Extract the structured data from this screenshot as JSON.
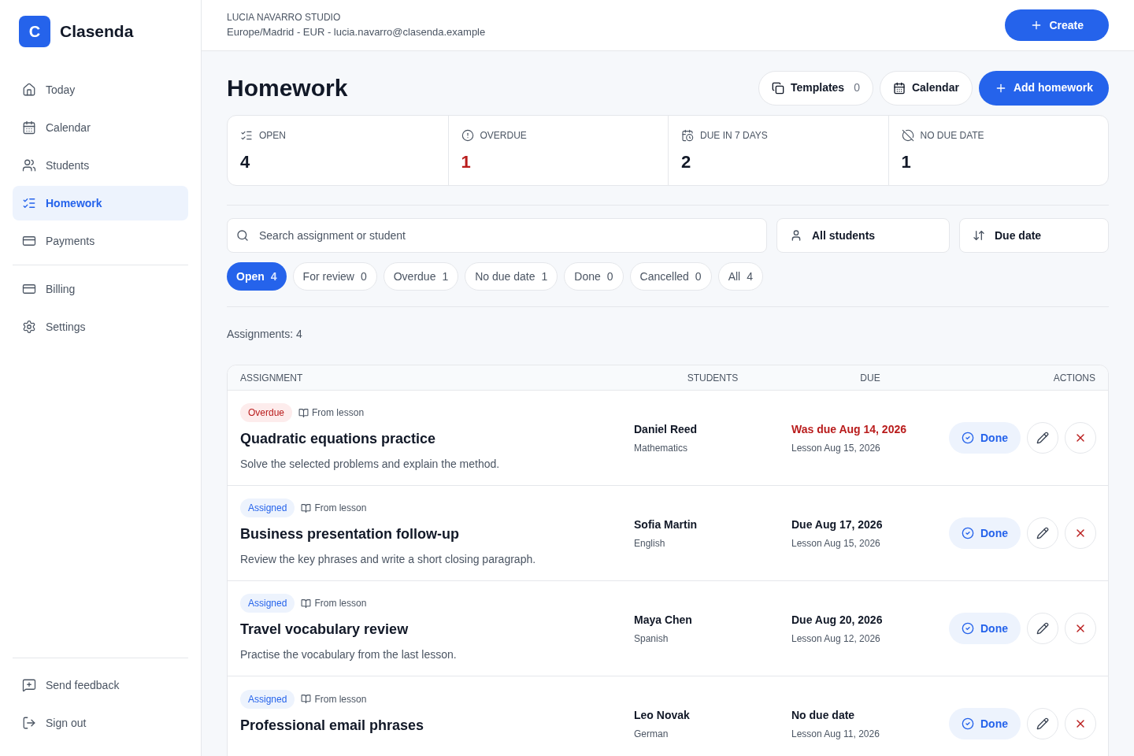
{
  "brand": {
    "logo_letter": "C",
    "name": "Clasenda"
  },
  "sidebar": {
    "items": [
      {
        "label": "Today",
        "kind": "home",
        "selected": false
      },
      {
        "label": "Calendar",
        "kind": "calendar",
        "selected": false
      },
      {
        "label": "Students",
        "kind": "users",
        "selected": false
      },
      {
        "label": "Homework",
        "kind": "list",
        "selected": true
      },
      {
        "label": "Payments",
        "kind": "card",
        "selected": false
      }
    ],
    "secondary": [
      {
        "label": "Billing",
        "kind": "card",
        "selected": false
      },
      {
        "label": "Settings",
        "kind": "gear",
        "selected": false
      }
    ],
    "footer": [
      {
        "label": "Send feedback",
        "kind": "feedback"
      },
      {
        "label": "Sign out",
        "kind": "signout"
      }
    ]
  },
  "header": {
    "studio": "LUCIA NAVARRO STUDIO",
    "details": "Europe/Madrid - EUR - lucia.navarro@clasenda.example",
    "create_button": "Create"
  },
  "page": {
    "title": "Homework",
    "templates_button": {
      "label": "Templates",
      "count": "0"
    },
    "calendar_button": "Calendar",
    "add_button": "Add homework"
  },
  "stats": [
    {
      "label": "OPEN",
      "value": "4",
      "kind": "list",
      "alert": false
    },
    {
      "label": "OVERDUE",
      "value": "1",
      "kind": "alert",
      "alert": true
    },
    {
      "label": "DUE IN 7 DAYS",
      "value": "2",
      "kind": "calclock",
      "alert": false
    },
    {
      "label": "NO DUE DATE",
      "value": "1",
      "kind": "off",
      "alert": false
    }
  ],
  "search": {
    "placeholder": "Search assignment or student"
  },
  "student_filter": "All students",
  "sort": "Due date",
  "filters": [
    {
      "label": "Open",
      "count": "4",
      "selected": true
    },
    {
      "label": "For review",
      "count": "0",
      "selected": false
    },
    {
      "label": "Overdue",
      "count": "1",
      "selected": false
    },
    {
      "label": "No due date",
      "count": "1",
      "selected": false
    },
    {
      "label": "Done",
      "count": "0",
      "selected": false
    },
    {
      "label": "Cancelled",
      "count": "0",
      "selected": false
    },
    {
      "label": "All",
      "count": "4",
      "selected": false
    }
  ],
  "summary": "Assignments: 4",
  "table": {
    "columns": [
      "ASSIGNMENT",
      "STUDENTS",
      "DUE",
      "ACTIONS"
    ],
    "rows": [
      {
        "status": {
          "kind": "overdue",
          "label": "Overdue"
        },
        "source": "From lesson",
        "title": "Quadratic equations practice",
        "description": "Solve the selected problems and explain the method.",
        "student": "Daniel Reed",
        "subject": "Mathematics",
        "due": "Was due Aug 14, 2026",
        "due_overdue": true,
        "lesson": "Lesson Aug 15, 2026",
        "done_button": "Done"
      },
      {
        "status": {
          "kind": "assigned",
          "label": "Assigned"
        },
        "source": "From lesson",
        "title": "Business presentation follow-up",
        "description": "Review the key phrases and write a short closing paragraph.",
        "student": "Sofia Martin",
        "subject": "English",
        "due": "Due Aug 17, 2026",
        "due_overdue": false,
        "lesson": "Lesson Aug 15, 2026",
        "done_button": "Done"
      },
      {
        "status": {
          "kind": "assigned",
          "label": "Assigned"
        },
        "source": "From lesson",
        "title": "Travel vocabulary review",
        "description": "Practise the vocabulary from the last lesson.",
        "student": "Maya Chen",
        "subject": "Spanish",
        "due": "Due Aug 20, 2026",
        "due_overdue": false,
        "lesson": "Lesson Aug 12, 2026",
        "done_button": "Done"
      },
      {
        "status": {
          "kind": "assigned",
          "label": "Assigned"
        },
        "source": "From lesson",
        "title": "Professional email phrases",
        "student": "Leo Novak",
        "subject": "German",
        "due": "No due date",
        "due_overdue": false,
        "lesson": "Lesson Aug 11, 2026",
        "done_button": "Done"
      }
    ]
  }
}
